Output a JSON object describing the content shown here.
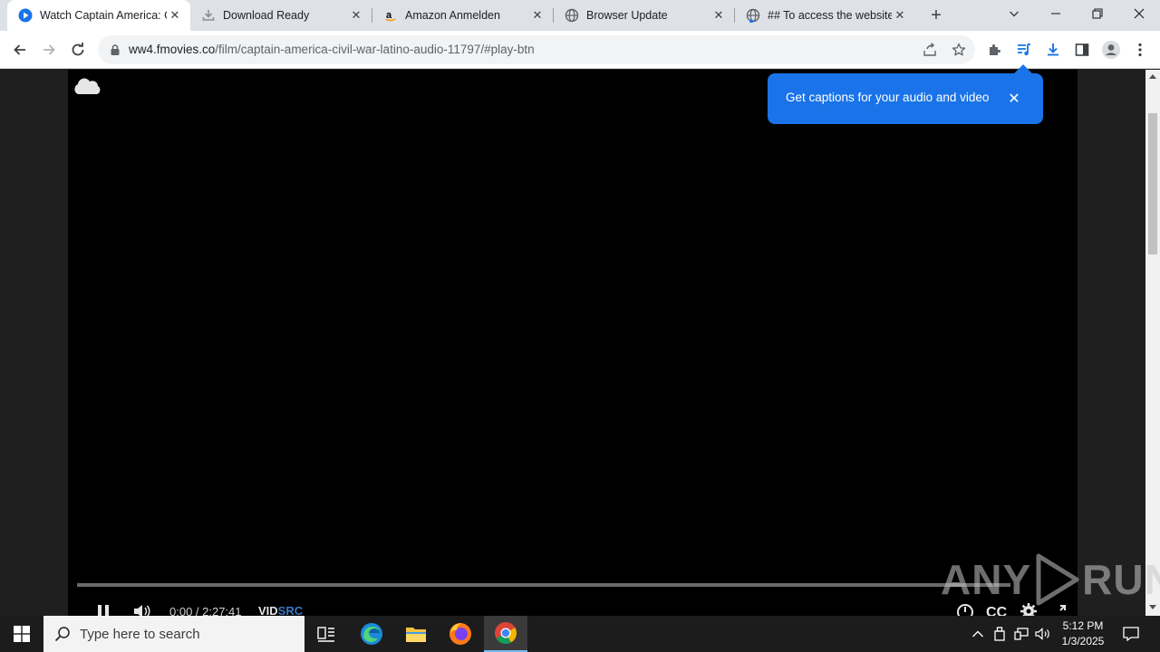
{
  "tabs": [
    {
      "title": "Watch Captain America: Civil War",
      "favicon": "play-circle-icon",
      "active": true
    },
    {
      "title": "Download Ready",
      "favicon": "download-icon",
      "active": false
    },
    {
      "title": "Amazon Anmelden",
      "favicon": "amazon-icon",
      "active": false
    },
    {
      "title": "Browser Update",
      "favicon": "globe-icon",
      "active": false
    },
    {
      "title": "## To access the website",
      "favicon": "globe-icon",
      "active": false
    }
  ],
  "address_bar": {
    "host": "ww4.fmovies.co",
    "path": "/film/captain-america-civil-war-latino-audio-11797/#play-btn"
  },
  "captions_popup": {
    "message": "Get captions for your audio and video"
  },
  "player": {
    "time": "0:00 / 2:27:41",
    "brand_a": "VID",
    "brand_b": "SRC"
  },
  "watermark": {
    "left": "ANY",
    "right": "RUN"
  },
  "taskbar": {
    "search_placeholder": "Type here to search",
    "time": "5:12 PM",
    "date": "1/3/2025"
  },
  "colors": {
    "accent_blue": "#1a73e8",
    "tab_strip": "#dee1e6",
    "player_bg": "#000000"
  }
}
